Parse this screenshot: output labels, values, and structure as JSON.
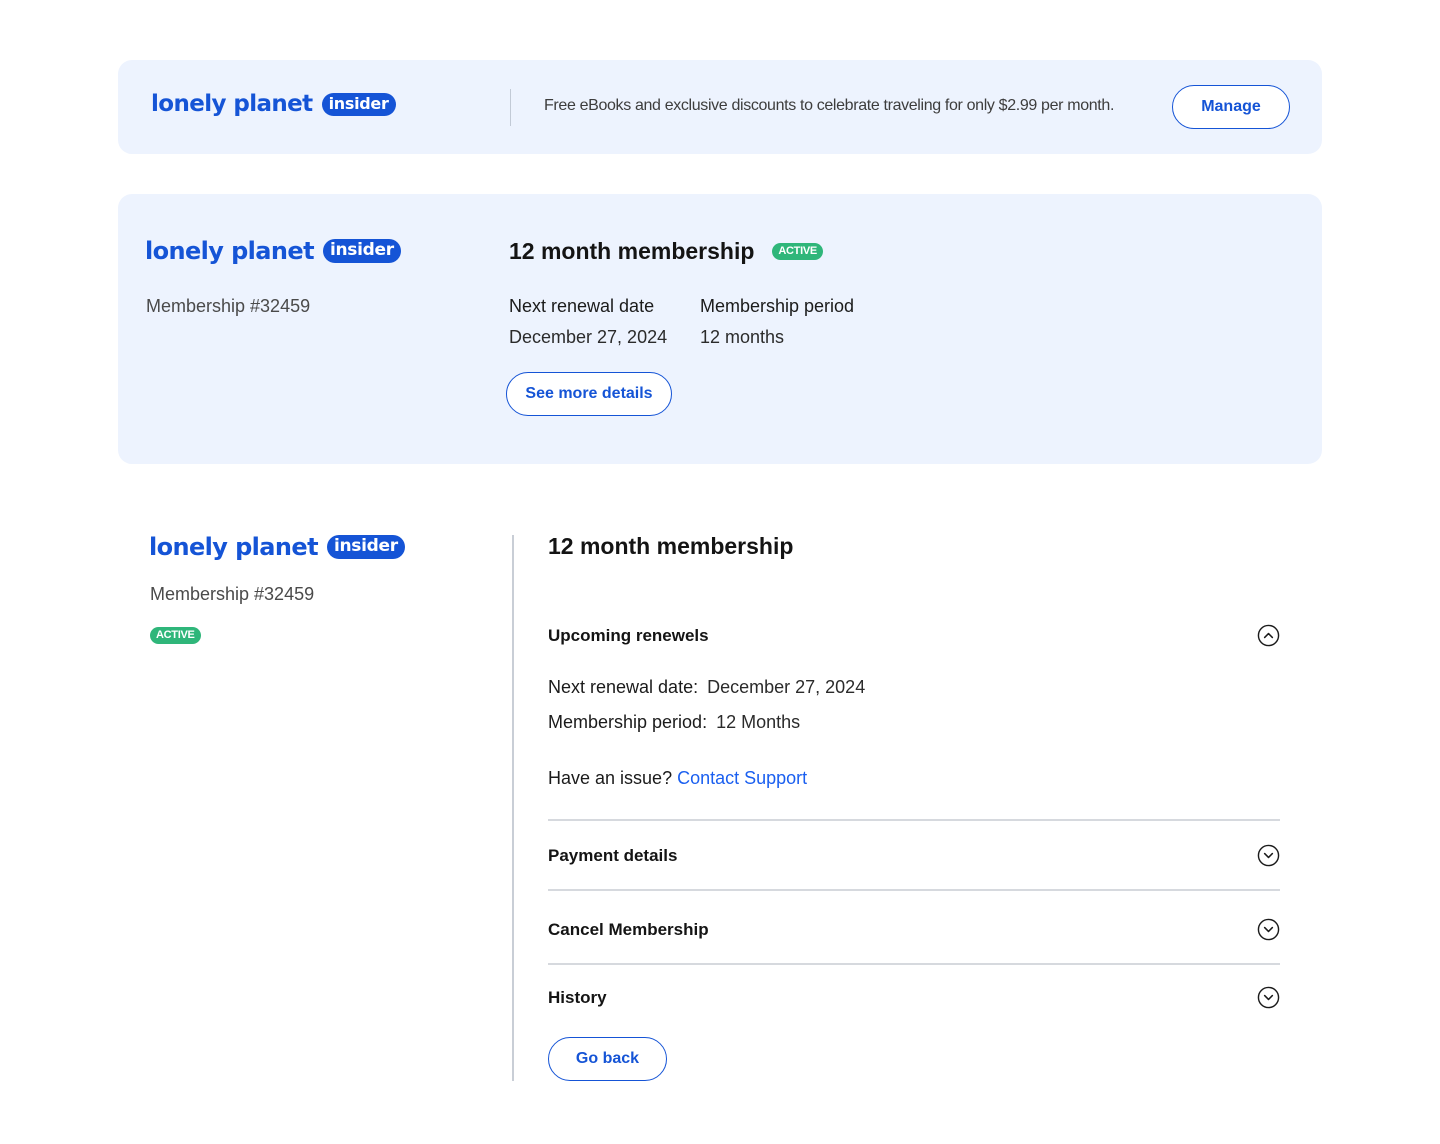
{
  "brand": {
    "wordmark": "lonely planet",
    "badge": "insider",
    "primary_color": "#1554d6"
  },
  "banner": {
    "promo_text": "Free eBooks and exclusive discounts to celebrate traveling for only $2.99 per month.",
    "manage_label": "Manage"
  },
  "summary": {
    "membership_number": "Membership #32459",
    "plan_title": "12 month membership",
    "status_badge": "ACTIVE",
    "next_renewal_label": "Next renewal date",
    "next_renewal_value": "December 27, 2024",
    "period_label": "Membership period",
    "period_value": "12 months",
    "details_button": "See more details"
  },
  "detail": {
    "membership_number": "Membership #32459",
    "status_badge": "ACTIVE",
    "plan_title": "12 month membership",
    "accordion": [
      {
        "label": "Upcoming renewels",
        "expanded": true,
        "icon": "chevron-up-circle-icon"
      },
      {
        "label": "Payment details",
        "expanded": false,
        "icon": "chevron-down-circle-icon"
      },
      {
        "label": "Cancel Membership",
        "expanded": false,
        "icon": "chevron-down-circle-icon"
      },
      {
        "label": "History",
        "expanded": false,
        "icon": "chevron-down-circle-icon"
      }
    ],
    "renewal": {
      "next_label": "Next renewal date:",
      "next_value": "December 27, 2024",
      "period_label": "Membership period:",
      "period_value": "12 Months",
      "issue_text": "Have an issue?",
      "support_link": "Contact Support"
    },
    "go_back_label": "Go back"
  },
  "colors": {
    "card_bg": "#edf3fe",
    "active_green": "#2fb67a",
    "link_blue": "#1a5ff0"
  }
}
